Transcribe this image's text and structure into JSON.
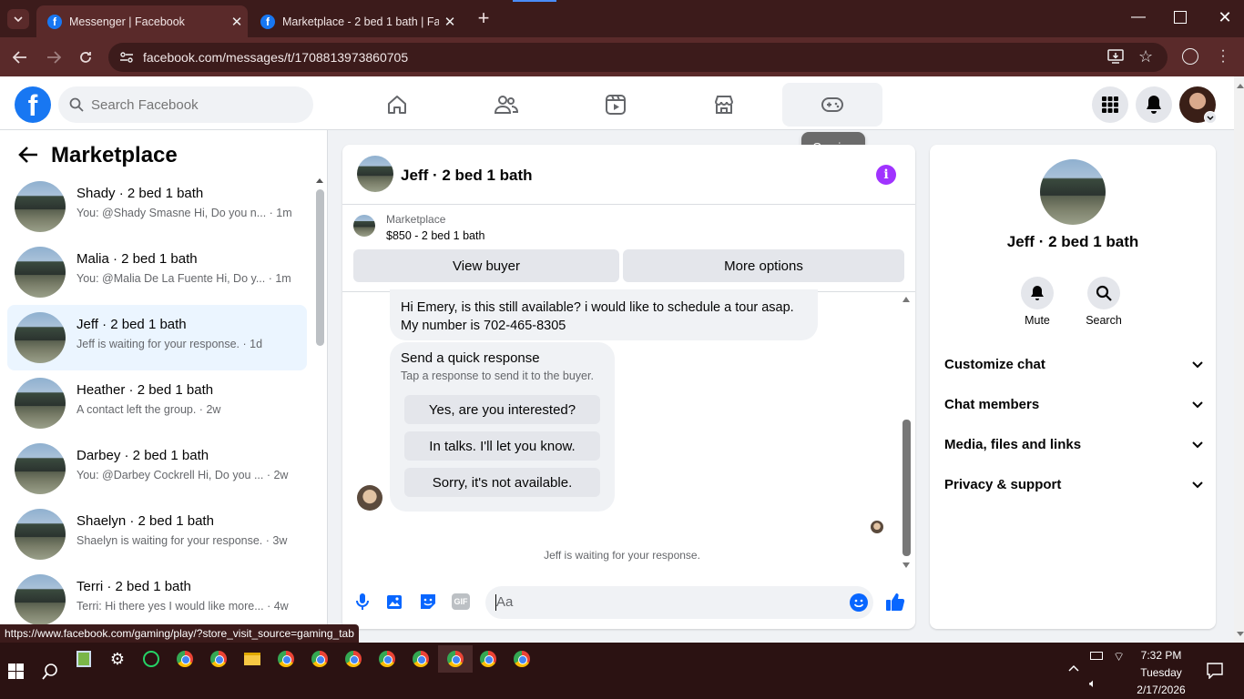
{
  "browser": {
    "tabs": [
      {
        "title": "Messenger | Facebook",
        "active": true
      },
      {
        "title": "Marketplace - 2 bed 1 bath | Fa",
        "active": false
      }
    ],
    "url": "facebook.com/messages/t/1708813973860705",
    "status_url": "https://www.facebook.com/gaming/play/?store_visit_source=gaming_tab"
  },
  "fb_header": {
    "search_placeholder": "Search Facebook",
    "tooltip": "Gaming",
    "accent": "#1877f2"
  },
  "left_panel": {
    "title": "Marketplace",
    "conversations": [
      {
        "name": "Shady · 2 bed 1 bath",
        "preview": "You: @Shady Smasne Hi, Do you n... · 1m"
      },
      {
        "name": "Malia · 2 bed 1 bath",
        "preview": "You: @Malia De La Fuente Hi, Do y... · 1m"
      },
      {
        "name": "Jeff · 2 bed 1 bath",
        "preview": "Jeff is waiting for your response. · 1d",
        "active": true
      },
      {
        "name": "Heather · 2 bed 1 bath",
        "preview": "A contact left the group. · 2w"
      },
      {
        "name": "Darbey · 2 bed 1 bath",
        "preview": "You: @Darbey Cockrell Hi, Do you ... · 2w"
      },
      {
        "name": "Shaelyn · 2 bed 1 bath",
        "preview": "Shaelyn is waiting for your response. · 3w"
      },
      {
        "name": "Terri · 2 bed 1 bath",
        "preview": "Terri: Hi there yes I would like more... · 4w"
      }
    ]
  },
  "chat": {
    "title": "Jeff · 2 bed 1 bath",
    "listing_label": "Marketplace",
    "listing_price": "$850 - 2 bed 1 bath",
    "view_buyer": "View buyer",
    "more_options": "More options",
    "message": "Hi Emery, is this still available? i would like to schedule a tour asap. My number is 702-465-8305",
    "quick_title": "Send a quick response",
    "quick_sub": "Tap a response to send it to the buyer.",
    "quick_replies": [
      "Yes, are you interested?",
      "In talks. I'll let you know.",
      "Sorry, it's not available."
    ],
    "waiting": "Jeff is waiting for your response.",
    "composer_placeholder": "Aa",
    "gif_label": "GIF"
  },
  "right_panel": {
    "name": "Jeff · 2 bed 1 bath",
    "mute": "Mute",
    "search": "Search",
    "sections": [
      "Customize chat",
      "Chat members",
      "Media, files and links",
      "Privacy & support"
    ]
  },
  "taskbar": {
    "time": "7:32 PM",
    "day": "Tuesday",
    "date": "2/17/2026"
  }
}
